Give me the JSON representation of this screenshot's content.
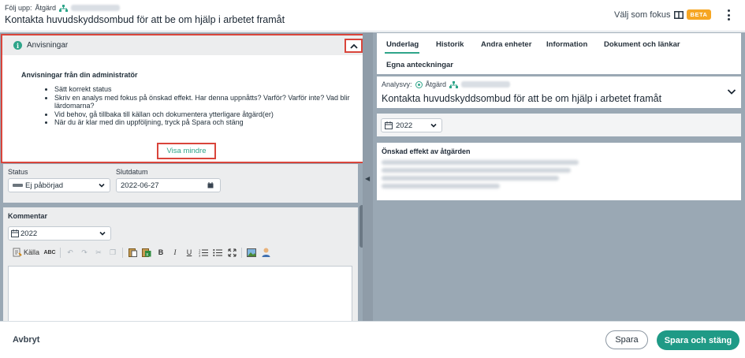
{
  "header": {
    "follow_label": "Följ upp:",
    "follow_type": "Åtgärd",
    "title": "Kontakta huvudskyddsombud för att be om hjälp i arbetet framåt",
    "focus_label": "Välj som fokus",
    "beta_badge": "BETA"
  },
  "instructions": {
    "header": "Anvisningar",
    "subtitle": "Anvisningar från din administratör",
    "items": [
      "Sätt korrekt status",
      "Skriv en analys med fokus på önskad effekt. Har denna uppnåtts? Varför? Varför inte? Vad blir lärdomarna?",
      "Vid behov, gå tillbaka till källan och dokumentera ytterligare åtgärd(er)",
      "När du är klar med din uppföljning, tryck på Spara och stäng"
    ],
    "show_less": "Visa mindre"
  },
  "status": {
    "label": "Status",
    "value": "Ej påbörjad",
    "end_label": "Slutdatum",
    "end_value": "2022-06-27"
  },
  "comment": {
    "label": "Kommentar",
    "year": "2022",
    "source_label": "Källa"
  },
  "tabs": [
    "Underlag",
    "Historik",
    "Andra enheter",
    "Information",
    "Dokument och länkar",
    "Egna anteckningar"
  ],
  "analysis": {
    "label": "Analysvy:",
    "type": "Åtgärd",
    "title": "Kontakta huvudskyddsombud för att be om hjälp i arbetet framåt"
  },
  "year_filter": "2022",
  "effect": {
    "heading": "Önskad effekt av åtgärden"
  },
  "footer": {
    "cancel": "Avbryt",
    "save": "Spara",
    "save_close": "Spara och stäng"
  },
  "colors": {
    "accent": "#2fa58a",
    "primary_button": "#1f9a86",
    "highlight_border": "#d9453b",
    "beta": "#f6a623"
  }
}
